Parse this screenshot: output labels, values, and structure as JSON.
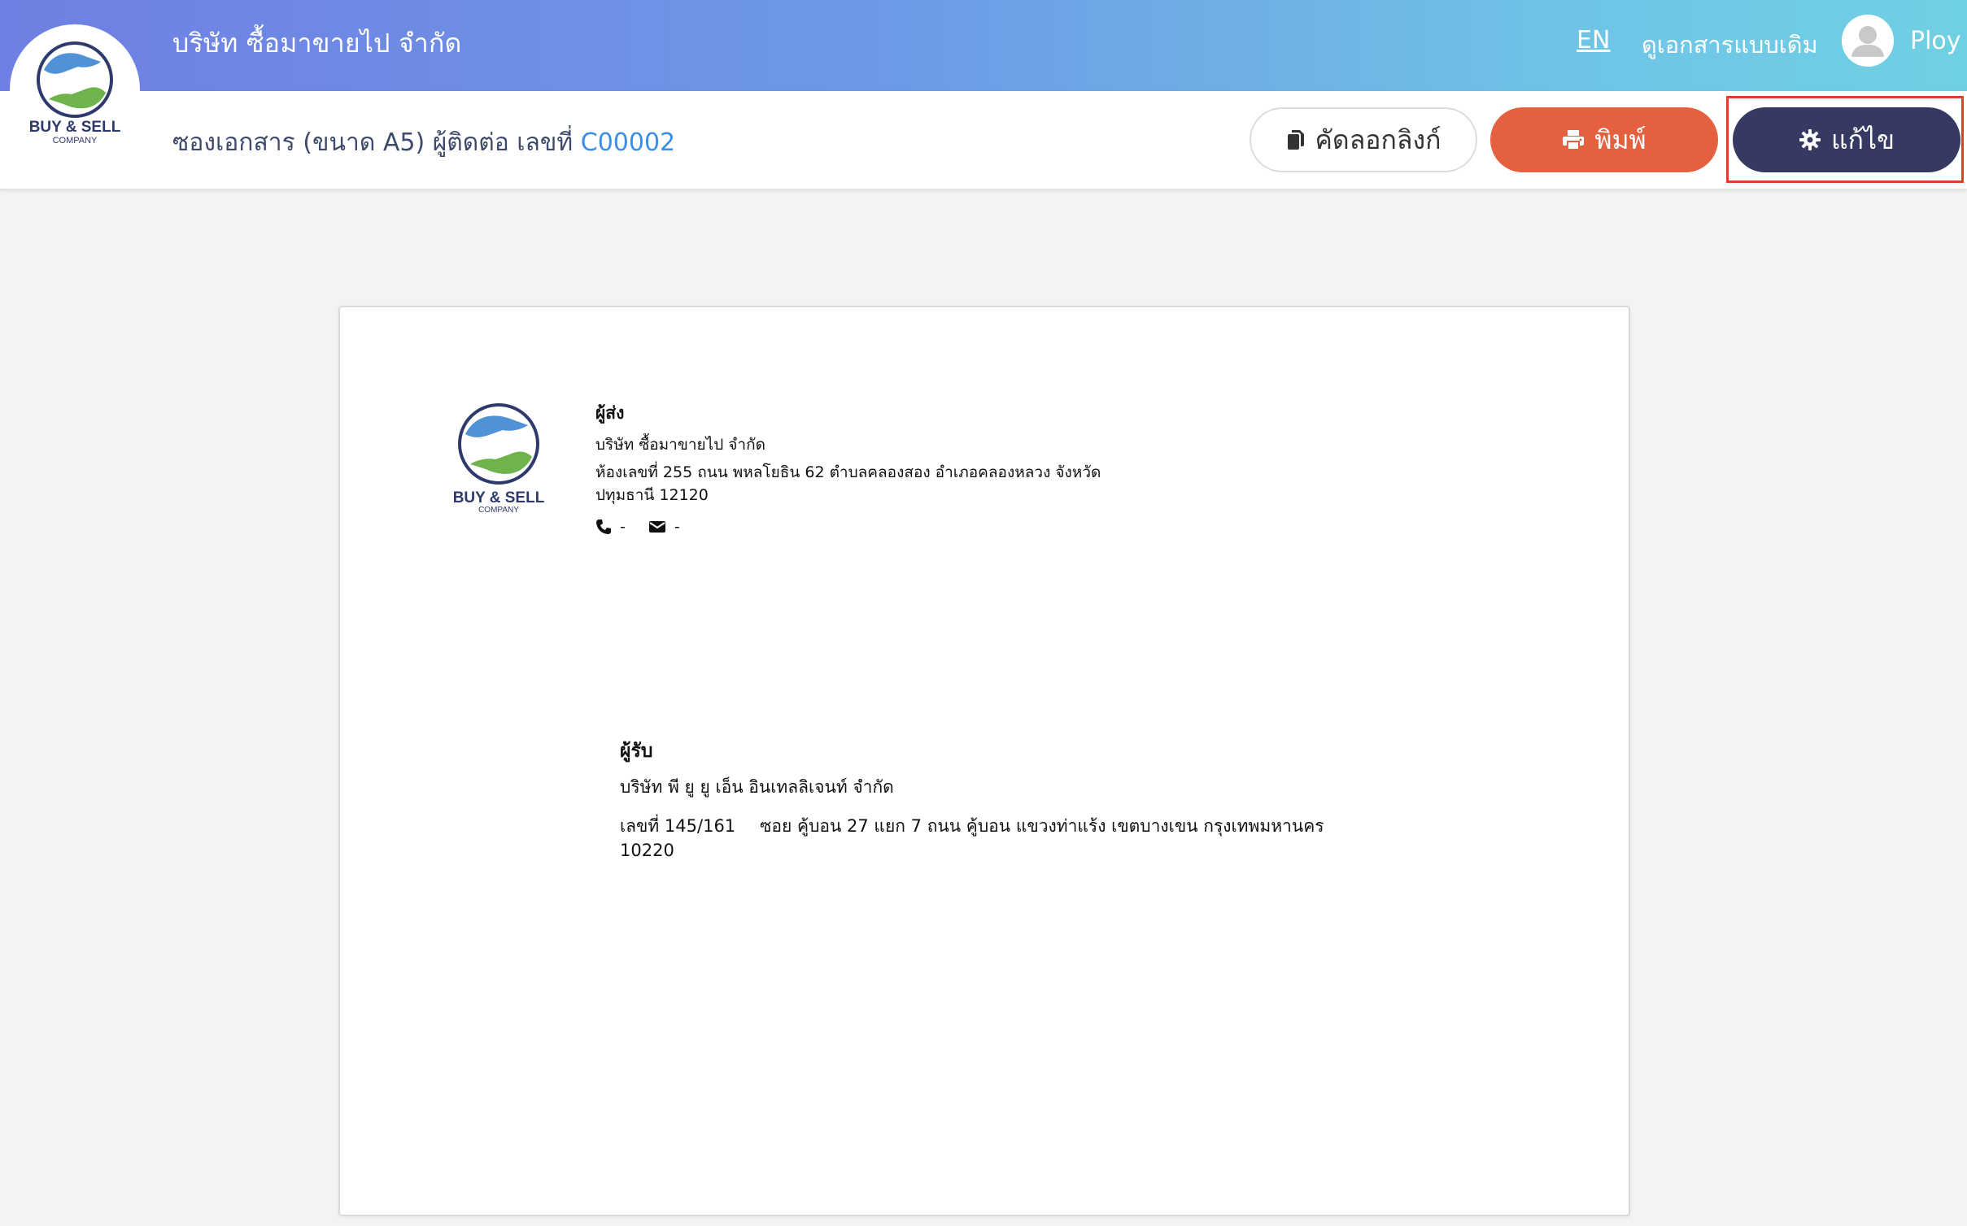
{
  "header": {
    "company_name": "บริษัท ซื้อมาขายไป จำกัด",
    "lang_link": "EN",
    "old_doc_link": "ดูเอกสารแบบเดิม",
    "user_name": "Ploy",
    "gradient_colors": [
      "#6f7fe3",
      "#70d0e3"
    ]
  },
  "logo": {
    "line1": "BUY & SELL",
    "line2": "COMPANY"
  },
  "subheader": {
    "doc_title": "ซองเอกสาร (ขนาด A5) ผู้ติดต่อ เลขที่",
    "doc_code": "C00002",
    "copy_button": "คัดลอกลิงก์",
    "print_button": "พิมพ์",
    "edit_button": "แก้ไข"
  },
  "colors": {
    "print": "#e4603f",
    "edit": "#363a63",
    "code": "#3a8ee6",
    "highlight": "#e0402b"
  },
  "envelope": {
    "sender": {
      "heading": "ผู้ส่ง",
      "company": "บริษัท ซื้อมาขายไป จำกัด",
      "address_line1": "ห้องเลขที่ 255 ถนน พหลโยธิน 62 ตำบลคลองสอง อำเภอคลองหลวง จังหวัด",
      "address_line2": "ปทุมธานี 12120",
      "phone": "-",
      "email": "-"
    },
    "recipient": {
      "heading": "ผู้รับ",
      "company": "บริษัท พี ยู ยู เอ็น อินเทลลิเจนท์ จำกัด",
      "address_number": "เลขที่ 145/161",
      "address_rest": "ซอย คู้บอน 27 แยก 7 ถนน คู้บอน  แขวงท่าแร้ง เขตบางเขน กรุงเทพมหานคร",
      "postal": "10220"
    }
  }
}
